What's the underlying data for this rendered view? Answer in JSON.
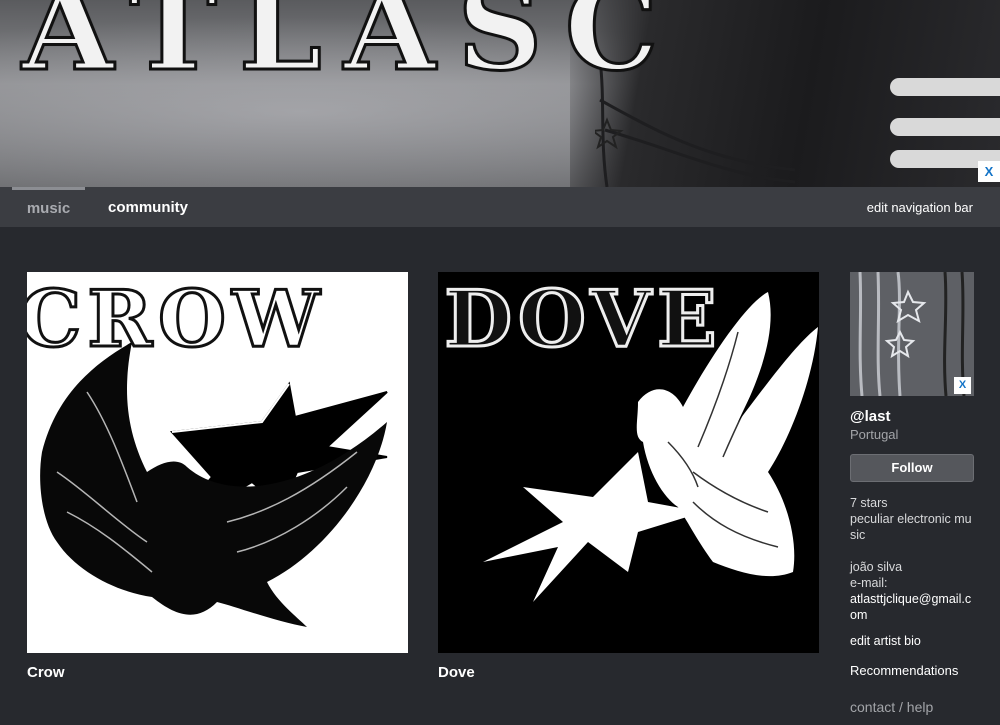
{
  "banner": {
    "title": "ATLASC",
    "close_label": "X"
  },
  "nav": {
    "tabs": [
      {
        "label": "music",
        "active": true
      },
      {
        "label": "community",
        "active": false
      }
    ],
    "edit_label": "edit navigation bar"
  },
  "albums": [
    {
      "title": "Crow",
      "art_text": "CROW",
      "art_style": "black-on-white"
    },
    {
      "title": "Dove",
      "art_text": "DOVE",
      "art_style": "white-on-black"
    }
  ],
  "sidebar": {
    "photo_close_label": "X",
    "artist_name": "@last",
    "location": "Portugal",
    "follow_label": "Follow",
    "bio_lines": [
      "7 stars",
      "peculiar electronic music"
    ],
    "contact_name": "joão silva",
    "email_label": "e-mail:",
    "email": "atlasttjclique@gmail.com",
    "edit_bio_label": "edit artist bio",
    "recommendations_label": "Recommendations",
    "contact_help_label": "contact / help"
  },
  "colors": {
    "page_bg": "#27292e",
    "nav_bg": "#3b3d42",
    "close_x": "#1273c7"
  },
  "icons": [
    "close-icon"
  ]
}
